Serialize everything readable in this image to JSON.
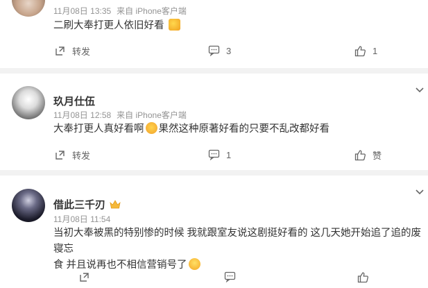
{
  "comments": [
    {
      "name": "",
      "meta": {
        "date": "11月08日 13:35",
        "source": "来自 iPhone客户端"
      },
      "text_before": "二刷大奉打更人依旧好看",
      "text_after": "",
      "emoji": "flower-emoji",
      "actions": {
        "repost": "转发",
        "comment": "3",
        "like": "1"
      }
    },
    {
      "name": "玖月仕伍",
      "meta": {
        "date": "11月08日 12:58",
        "source": "来自 iPhone客户端"
      },
      "text_before": "大奉打更人真好看啊",
      "text_after": "果然这种原著好看的只要不乱改都好看",
      "emoji": "heart-eyes-emoji",
      "actions": {
        "repost": "转发",
        "comment": "1",
        "like": "赞"
      }
    },
    {
      "name": "借此三千刃",
      "meta": {
        "date": "11月08日 11:54",
        "source": ""
      },
      "text_line1": "当初大奉被黑的特别惨的时候 我就跟室友说这剧挺好看的 这几天她开始追了追的废寝忘",
      "text_line2": "食 并且说再也不相信营销号了",
      "emoji": "laughing-emoji",
      "badge": "crown-badge-icon"
    }
  ],
  "colors": {
    "meta": "#939393",
    "separator": "#f2f2f2",
    "text": "#333333"
  }
}
